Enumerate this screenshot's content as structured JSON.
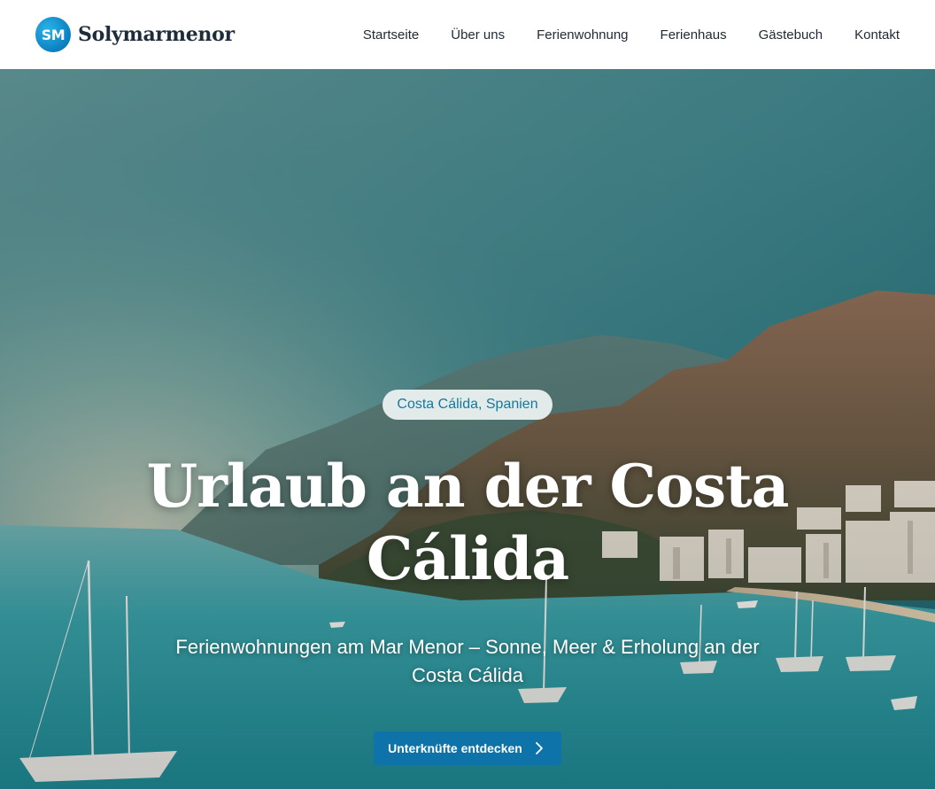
{
  "brand": {
    "logo_initials": "SM",
    "name": "Solymarmenor"
  },
  "nav": {
    "items": [
      {
        "label": "Startseite"
      },
      {
        "label": "Über uns"
      },
      {
        "label": "Ferienwohnung"
      },
      {
        "label": "Ferienhaus"
      },
      {
        "label": "Gästebuch"
      },
      {
        "label": "Kontakt"
      }
    ]
  },
  "hero": {
    "location_badge": "Costa Cálida, Spanien",
    "title": "Urlaub an der Costa Cálida",
    "subtitle": "Ferienwohnungen am Mar Menor – Sonne, Meer & Erholung an der Costa Cálida",
    "cta_label": "Unterknüfte entdecken",
    "cta_icon": "chevron-right-icon",
    "background_image": "coastal-bay-with-sailboats-and-mountains"
  },
  "colors": {
    "accent": "#0d73a8",
    "badge_text": "#137a9c",
    "nav_text": "#1f2933"
  }
}
